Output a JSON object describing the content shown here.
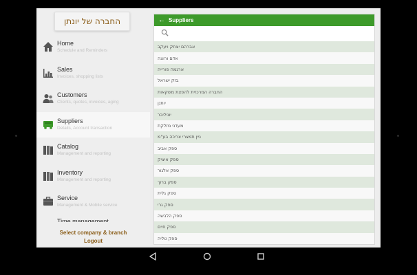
{
  "company": {
    "name": "החברה של יונתן"
  },
  "nav": [
    {
      "title": "Home",
      "subtitle": "Schedule and Reminders",
      "icon": "home-icon"
    },
    {
      "title": "Sales",
      "subtitle": "Invoices, shopping lists",
      "icon": "bar-chart-icon"
    },
    {
      "title": "Customers",
      "subtitle": "Clients, quotes, invoices, aging",
      "icon": "people-icon"
    },
    {
      "title": "Suppliers",
      "subtitle": "Details, Account transaction",
      "icon": "truck-icon"
    },
    {
      "title": "Catalog",
      "subtitle": "Management and reporting",
      "icon": "book-icon"
    },
    {
      "title": "Inventory",
      "subtitle": "Management and reporting",
      "icon": "book-icon"
    },
    {
      "title": "Service",
      "subtitle": "Management & Mobile service",
      "icon": "briefcase-icon"
    },
    {
      "title": "Time management",
      "subtitle": "",
      "icon": ""
    }
  ],
  "bottom": {
    "select_company": "Select company & branch",
    "logout": "Logout"
  },
  "panel": {
    "title": "Suppliers",
    "search_placeholder": "",
    "suppliers": [
      "אברהם יצחק ויעקב",
      "אדם ורוצה",
      "ארגמה פורייה",
      "בזק ישראל",
      "החברה המרכזית להפצת משקאות",
      "יותנן",
      "יוניליבר",
      "מעדני מזלקת",
      "ניין תמצרי צריכה בע\"מ",
      "ספק אביב",
      "ספק איציק",
      "ספק אלגור",
      "ספק ברוך",
      "ספק גלית",
      "ספק גרי",
      "ספק הלבשה",
      "ספק חיים",
      "ספק טליה"
    ]
  },
  "colors": {
    "header_green": "#3d9a2a",
    "accent_brown": "#8b5e1a",
    "row_alt": "#dfe8dd"
  }
}
